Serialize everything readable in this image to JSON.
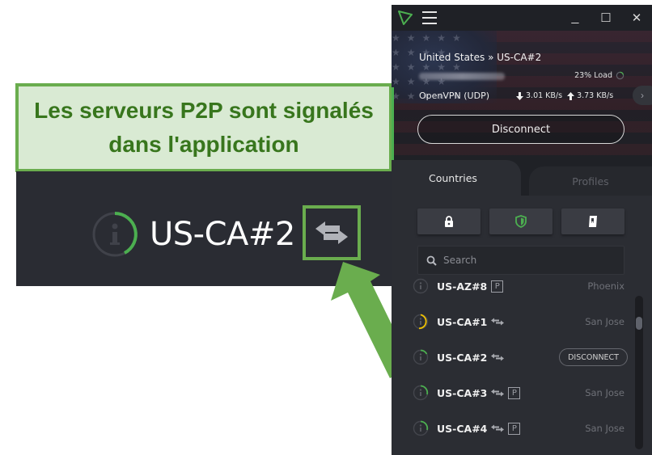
{
  "annotation": {
    "callout_line1": "Les serveurs P2P sont signalés",
    "callout_line2": "dans l'application",
    "accent_color": "#6aad4e",
    "text_color": "#38761d",
    "background": "#d9ead3"
  },
  "zoom_detail": {
    "server_name": "US-CA#2",
    "load_icon": "info-load-ring-icon",
    "p2p_icon": "p2p-arrows-icon"
  },
  "app": {
    "titlebar": {
      "logo_icon": "protonvpn-logo-icon",
      "menu_icon": "hamburger-menu-icon",
      "minimize": "_",
      "maximize": "☐",
      "close": "✕"
    },
    "connection": {
      "title": "United States » US-CA#2",
      "ip_blurred": "IP ███.██.███.██",
      "load": "23% Load",
      "load_percent": 23,
      "protocol": "OpenVPN (UDP)",
      "download": "3.01 KB/s",
      "upload": "3.73 KB/s",
      "expand": "›",
      "disconnect_label": "Disconnect"
    },
    "tabs": [
      {
        "label": "Countries",
        "active": true
      },
      {
        "label": "Profiles",
        "active": false
      }
    ],
    "filters": [
      {
        "name": "secure-core",
        "icon": "lock-icon"
      },
      {
        "name": "netshield",
        "icon": "shield-icon"
      },
      {
        "name": "kill-switch",
        "icon": "switch-icon"
      }
    ],
    "search": {
      "placeholder": "Search",
      "value": ""
    },
    "servers": [
      {
        "name": "US-AZ#8",
        "p2p": false,
        "plus": true,
        "city": "Phoenix",
        "load_color": "#55575e",
        "load": 0
      },
      {
        "name": "US-CA#1",
        "p2p": true,
        "plus": false,
        "city": "San Jose",
        "load_color": "#f2c300",
        "load": 55
      },
      {
        "name": "US-CA#2",
        "p2p": true,
        "plus": false,
        "city": "",
        "action": "DISCONNECT",
        "load_color": "#4caf50",
        "load": 23
      },
      {
        "name": "US-CA#3",
        "p2p": true,
        "plus": true,
        "city": "San Jose",
        "load_color": "#4caf50",
        "load": 30
      },
      {
        "name": "US-CA#4",
        "p2p": true,
        "plus": true,
        "city": "San Jose",
        "load_color": "#4caf50",
        "load": 30
      }
    ],
    "plus_badge": "P"
  }
}
